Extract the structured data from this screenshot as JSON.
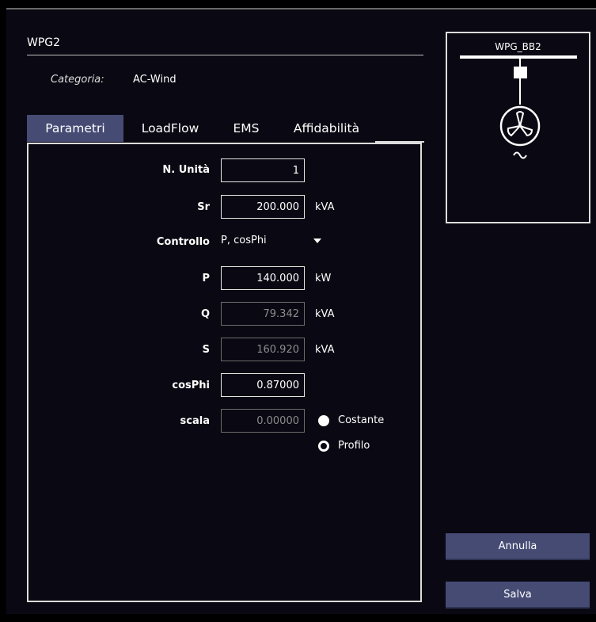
{
  "element": {
    "name": "WPG2",
    "category_label": "Categoria:",
    "category_value": "AC-Wind"
  },
  "tabs": [
    "Parametri",
    "LoadFlow",
    "EMS",
    "Affidabilità"
  ],
  "active_tab": "Parametri",
  "params": {
    "n_unita": {
      "label": "N. Unità",
      "value": "1"
    },
    "sr": {
      "label": "Sr",
      "value": "200.000",
      "unit": "kVA"
    },
    "controllo": {
      "label": "Controllo",
      "value": "P, cosPhi"
    },
    "p": {
      "label": "P",
      "value": "140.000",
      "unit": "kW"
    },
    "q": {
      "label": "Q",
      "value": "79.342",
      "unit": "kVA"
    },
    "s": {
      "label": "S",
      "value": "160.920",
      "unit": "kVA"
    },
    "cosphi": {
      "label": "cosPhi",
      "value": "0.87000"
    },
    "scala": {
      "label": "scala",
      "value": "0.00000"
    }
  },
  "mode_options": {
    "costante": "Costante",
    "profilo": "Profilo",
    "selected": "Costante"
  },
  "schematic": {
    "busbar_label": "WPG_BB2",
    "icon": "wind-generator-icon"
  },
  "buttons": {
    "annulla": "Annulla",
    "salva": "Salva"
  },
  "colors": {
    "background": "#0a0812",
    "accent": "#454b73",
    "border": "#dcdcdc"
  }
}
